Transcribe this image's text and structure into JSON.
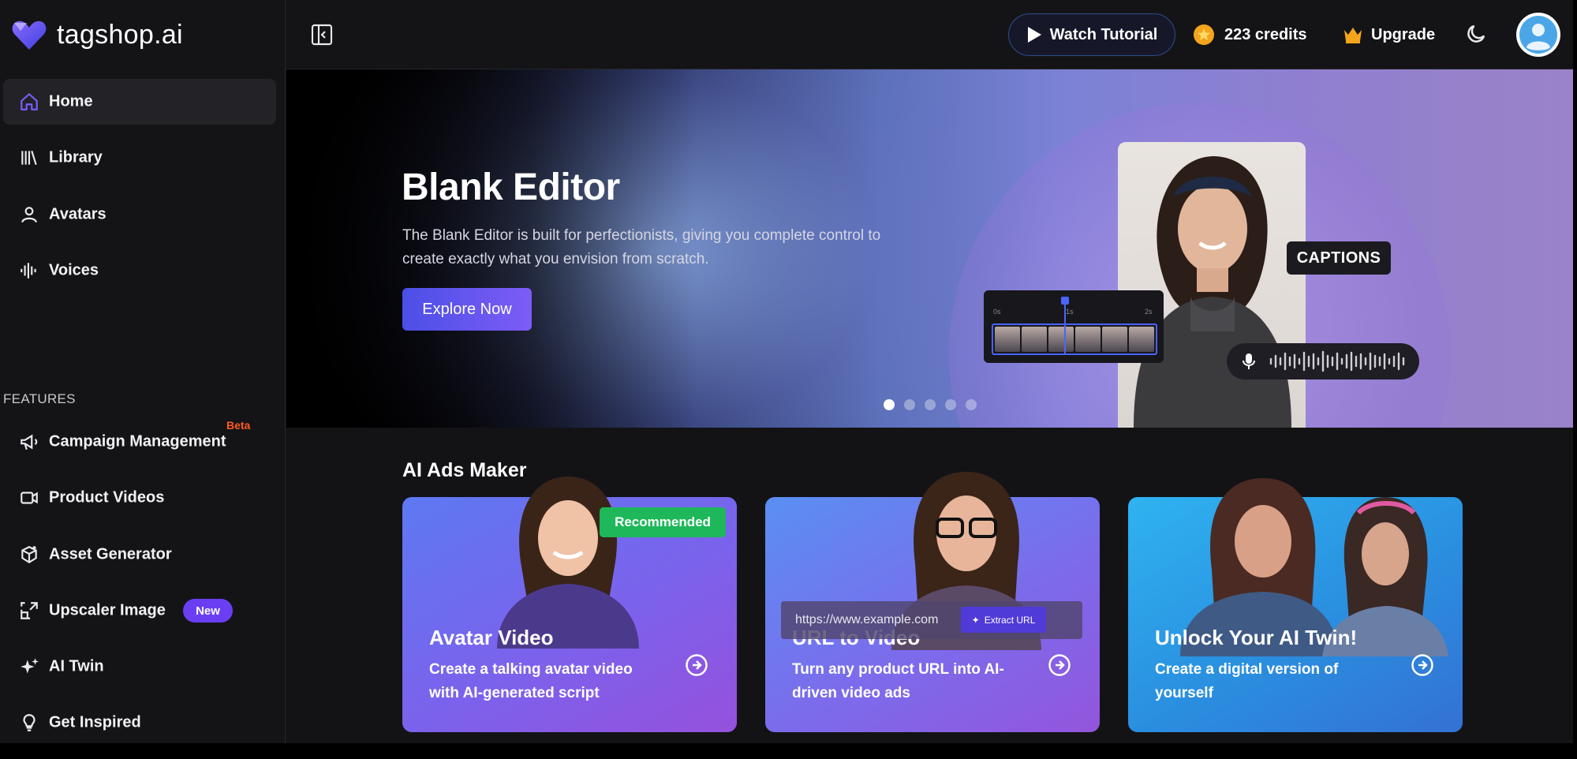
{
  "brand": {
    "name": "tagshop.ai"
  },
  "sidebar": {
    "main_items": [
      {
        "label": "Home",
        "icon": "home-icon",
        "active": true
      },
      {
        "label": "Library",
        "icon": "library-icon"
      },
      {
        "label": "Avatars",
        "icon": "user-icon"
      },
      {
        "label": "Voices",
        "icon": "waveform-icon"
      }
    ],
    "features_label": "FEATURES",
    "feature_items": [
      {
        "label": "Campaign Management",
        "icon": "megaphone-icon",
        "badge": "Beta"
      },
      {
        "label": "Product Videos",
        "icon": "video-camera-icon"
      },
      {
        "label": "Asset Generator",
        "icon": "cube-plus-icon"
      },
      {
        "label": "Upscaler Image",
        "icon": "upscale-icon",
        "badge": "New"
      },
      {
        "label": "AI Twin",
        "icon": "sparkles-icon"
      },
      {
        "label": "Get Inspired",
        "icon": "lightbulb-icon"
      }
    ]
  },
  "topbar": {
    "watch_tutorial": "Watch Tutorial",
    "credits": "223 credits",
    "upgrade": "Upgrade"
  },
  "hero": {
    "title": "Blank Editor",
    "description": "The Blank Editor is built for perfectionists, giving you complete control to create exactly what you envision from scratch.",
    "cta": "Explore Now",
    "captions_tag": "CAPTIONS",
    "timeline_ticks": [
      "0s",
      "1s",
      "2s"
    ],
    "slides": 5,
    "active_slide": 1
  },
  "ads_maker": {
    "title": "AI Ads Maker",
    "cards": [
      {
        "title": "Avatar Video",
        "description": "Create a talking avatar video with AI-generated script",
        "tag": "Recommended"
      },
      {
        "title": "URL to Video",
        "description": "Turn any product URL into AI-driven video ads",
        "url_placeholder": "https://www.example.com",
        "extract_label": "Extract URL"
      },
      {
        "title": "Unlock Your AI Twin!",
        "description": "Create a digital version of yourself"
      }
    ]
  },
  "colors": {
    "accent": "#6a3ff4",
    "beta": "#ff5a1f",
    "recommended": "#1eb85a",
    "cta_start": "#4b4fe6",
    "cta_end": "#7d5cf7"
  }
}
